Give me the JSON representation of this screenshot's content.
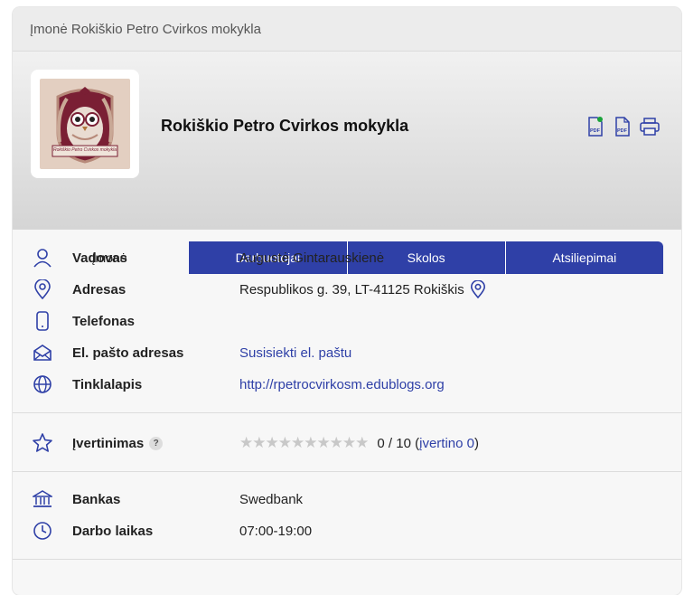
{
  "breadcrumb": "Įmonė Rokiškio Petro Cvirkos mokykla",
  "company": {
    "name": "Rokiškio Petro Cvirkos mokykla",
    "logo_text": "Rokiškio Petro Cvirkos mokykla"
  },
  "actions": {
    "pdf_icon_1": "pdf-icon",
    "pdf_icon_2": "pdf-icon",
    "print_icon": "printer-icon",
    "pdf_label": "PDF"
  },
  "tabs": [
    {
      "label": "Įmonė",
      "active": true
    },
    {
      "label": "Darbuotojai",
      "active": false
    },
    {
      "label": "Skolos",
      "active": false
    },
    {
      "label": "Atsiliepimai",
      "active": false
    }
  ],
  "info": {
    "manager": {
      "label": "Vadovas",
      "value": "Augustė Gintarauskienė"
    },
    "address": {
      "label": "Adresas",
      "value": "Respublikos g. 39, LT-41125 Rokiškis"
    },
    "phone": {
      "label": "Telefonas",
      "value": ""
    },
    "email": {
      "label": "El. pašto adresas",
      "value": "Susisiekti el. paštu"
    },
    "website": {
      "label": "Tinklalapis",
      "value": "http://rpetrocvirkosm.edublogs.org"
    }
  },
  "rating": {
    "label": "Įvertinimas",
    "help": "?",
    "stars": "★★★★★★★★★★",
    "score": "0 / 10 (",
    "count_link": "įvertino 0",
    "close": ")",
    "value": 0,
    "max": 10
  },
  "extra": {
    "bank": {
      "label": "Bankas",
      "value": "Swedbank"
    },
    "hours": {
      "label": "Darbo laikas",
      "value": "07:00-19:00"
    }
  },
  "colors": {
    "accent": "#2f40a7",
    "badge_green": "#1aa33a",
    "logo_maroon": "#7a1f34"
  }
}
